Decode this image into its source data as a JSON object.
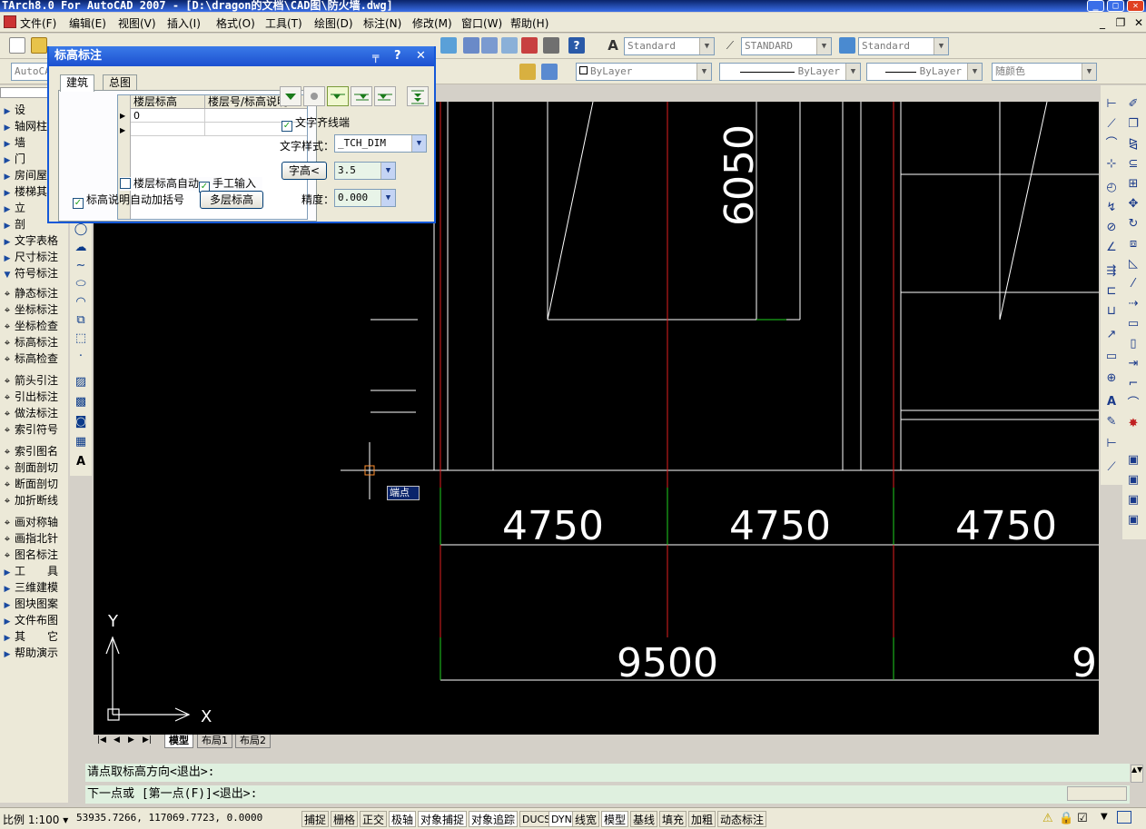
{
  "window": {
    "title": "TArch8.0 For AutoCAD 2007 - [D:\\dragon的文档\\CAD图\\防火墙.dwg]",
    "min_label": "_",
    "max_label": "□",
    "close_label": "✕"
  },
  "menu": [
    "文件(F)",
    "编辑(E)",
    "视图(V)",
    "插入(I)",
    "格式(O)",
    "工具(T)",
    "绘图(D)",
    "标注(N)",
    "修改(M)",
    "窗口(W)",
    "帮助(H)"
  ],
  "mdi": {
    "min": "_",
    "restore": "❐",
    "close": "✕"
  },
  "toolbar_styles": {
    "text_style": "Standard",
    "dim_style": "STANDARD",
    "table_style": "Standard"
  },
  "toolbar_layers": {
    "workspace": "AutoCAD",
    "color": "ByLayer",
    "linetype": "ByLayer",
    "lineweight": "ByLayer",
    "plotstyle": "随颜色"
  },
  "left_panel": [
    {
      "icon": "tri",
      "label": "设"
    },
    {
      "icon": "tri",
      "label": "轴网柱"
    },
    {
      "icon": "tri",
      "label": "墙"
    },
    {
      "icon": "tri",
      "label": "门"
    },
    {
      "icon": "tri",
      "label": "房间屋"
    },
    {
      "icon": "tri",
      "label": "楼梯其"
    },
    {
      "icon": "tri",
      "label": "立"
    },
    {
      "icon": "tri",
      "label": "剖"
    },
    {
      "icon": "tri",
      "label": "文字表格"
    },
    {
      "icon": "tri",
      "label": "尺寸标注"
    },
    {
      "icon": "open",
      "label": "符号标注"
    },
    {
      "icon": "sym",
      "label": "静态标注"
    },
    {
      "icon": "sym",
      "label": "坐标标注"
    },
    {
      "icon": "sym",
      "label": "坐标检查"
    },
    {
      "icon": "sym",
      "label": "标高标注"
    },
    {
      "icon": "sym",
      "label": "标高检查"
    },
    {
      "icon": "sym",
      "label": "箭头引注"
    },
    {
      "icon": "sym",
      "label": "引出标注"
    },
    {
      "icon": "sym",
      "label": "做法标注"
    },
    {
      "icon": "sym",
      "label": "索引符号"
    },
    {
      "icon": "sym",
      "label": "索引图名"
    },
    {
      "icon": "sym",
      "label": "剖面剖切"
    },
    {
      "icon": "sym",
      "label": "断面剖切"
    },
    {
      "icon": "sym",
      "label": "加折断线"
    },
    {
      "icon": "sym",
      "label": "画对称轴"
    },
    {
      "icon": "sym",
      "label": "画指北针"
    },
    {
      "icon": "sym",
      "label": "图名标注"
    },
    {
      "icon": "tri",
      "label": "工　　具"
    },
    {
      "icon": "tri",
      "label": "三维建模"
    },
    {
      "icon": "tri",
      "label": "图块图案"
    },
    {
      "icon": "tri",
      "label": "文件布图"
    },
    {
      "icon": "tri",
      "label": "其　　它"
    },
    {
      "icon": "tri",
      "label": "帮助演示"
    }
  ],
  "dialog": {
    "title": "标高标注",
    "pin": "╤",
    "help": "?",
    "close": "✕",
    "tabs": [
      "建筑",
      "总图"
    ],
    "table_headers": [
      "楼层标高",
      "楼层号/标高说明"
    ],
    "row_value": "0",
    "chk_auto_bracket_level": "楼层标高自动加括号",
    "chk_manual_input": "手工输入",
    "chk_auto_bracket_desc": "标高说明自动加括号",
    "btn_multi": "多层标高",
    "chk_align": "文字齐线端",
    "text_style_label": "文字样式：",
    "text_style_value": "_TCH_DIM",
    "btn_height": "字高<",
    "height_value": "3.5",
    "precision_label": "精度：",
    "precision_value": "0.000"
  },
  "canvas": {
    "dims_row1": [
      "4750",
      "4750",
      "4750"
    ],
    "dims_row2": [
      "9500",
      "9"
    ],
    "vertical_dim": "6050",
    "snap_tooltip": "端点",
    "ucs_x": "X",
    "ucs_y": "Y"
  },
  "layout_tabs": {
    "model": "模型",
    "layout1": "布局1",
    "layout2": "布局2"
  },
  "command": {
    "line1": "请点取标高方向<退出>:",
    "line2": "下一点或 [第一点(F)]<退出>:"
  },
  "status": {
    "scale": "比例 1:100 ▾",
    "coords": "53935.7266, 117069.7723, 0.0000",
    "buttons": [
      "捕捉",
      "栅格",
      "正交",
      "极轴",
      "对象捕捉",
      "对象追踪",
      "DUCS",
      "DYN",
      "线宽",
      "模型",
      "基线",
      "填充",
      "加粗",
      "动态标注"
    ]
  }
}
